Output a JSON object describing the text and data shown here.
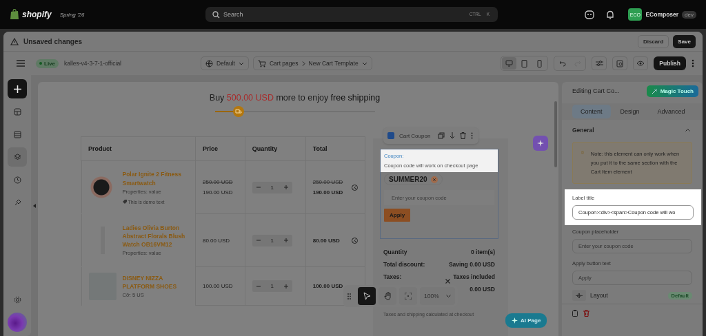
{
  "top_bar": {
    "logo": "shopify",
    "version": "Spring '26",
    "search": {
      "placeholder": "Search",
      "shortcut": [
        "CTRL",
        "K"
      ]
    },
    "account": {
      "initials": "ECO",
      "name": "EComposer",
      "badge": "dev"
    }
  },
  "unsaved_bar": {
    "message": "Unsaved changes",
    "buttons": [
      {
        "label": "Discard",
        "kind": "secondary"
      },
      {
        "label": "Save",
        "kind": "primary"
      }
    ]
  },
  "editor_toolbar": {
    "status": "Live",
    "theme": "kalles-v4-3-7-1-official",
    "language": "Default",
    "breadcrumb": [
      "Cart pages",
      "New Cart Template"
    ],
    "devices": [
      {
        "kind": "desktop",
        "selected": true
      },
      {
        "kind": "tablet",
        "selected": false
      },
      {
        "kind": "mobile",
        "selected": false
      }
    ],
    "history": [
      {
        "kind": "undo",
        "disabled": false
      },
      {
        "kind": "redo",
        "disabled": true
      }
    ],
    "publish": "Publish"
  },
  "sidebar": {
    "items": [
      {
        "kind": "add",
        "selected": false
      },
      {
        "kind": "blocks",
        "selected": false
      },
      {
        "kind": "sections",
        "selected": false
      },
      {
        "kind": "layers",
        "selected": true
      },
      {
        "kind": "history",
        "selected": false
      },
      {
        "kind": "style",
        "selected": false
      },
      {
        "kind": "settings",
        "selected": false
      }
    ]
  },
  "canvas": {
    "shipping": {
      "prefix": "Buy",
      "amount": "500.00 USD",
      "middle": "more to enjoy",
      "highlight": "free shipping",
      "level": 0.15
    },
    "cart_table": {
      "columns": [
        "Product",
        "Price",
        "Quantity",
        "Total"
      ],
      "rows": [
        {
          "name": "Polar Ignite 2 Fitness Smartwatch",
          "properties": "Properties: value",
          "note": "This is demo text",
          "price_original": "250.00 USD",
          "price": "190.00 USD",
          "quantity": "1",
          "total_original": "250.00 USD",
          "total": "190.00 USD",
          "remove_button": true
        },
        {
          "name": "Ladies Olivia Burton Abstract Florals Blush Watch OB16VM12",
          "properties": "Properties: value",
          "price": "80.00 USD",
          "quantity": "1",
          "total": "80.00 USD",
          "remove_button": true
        },
        {
          "name": "DISNEY NIZZA PLATFORM SHOES",
          "properties": "Cỡ: 5 US",
          "price": "100.00 USD",
          "quantity": "1",
          "total": "100.00 USD",
          "remove_button": false
        }
      ]
    },
    "element_toolbar": {
      "label": "Cart Coupon"
    },
    "coupon": {
      "highlighted": true,
      "title": "Coupon:",
      "text": "Coupon code will work on checkout page",
      "applied_code": "SUMMER20",
      "placeholder": "Enter your coupon code",
      "button": "Apply"
    },
    "summary": {
      "rows": [
        {
          "label": "Quantity",
          "value": "0 item(s)"
        },
        {
          "label": "Total discount:",
          "value": "Saving 0.00 USD"
        },
        {
          "label": "Taxes:",
          "value": "Taxes included"
        },
        {
          "value": "0.00 USD"
        }
      ],
      "note": "Taxes and shipping calculated at checkout"
    },
    "zoom_toolbar": {
      "tools": [
        {
          "kind": "select",
          "selected": true
        },
        {
          "kind": "hand",
          "selected": false
        },
        {
          "kind": "fit",
          "selected": false
        }
      ],
      "zoom": "100%"
    },
    "ai_button": "AI Page"
  },
  "right_panel": {
    "title": "Editing Cart Co...",
    "magic_button": "Magic Touch",
    "tabs": [
      {
        "label": "Content",
        "selected": true
      },
      {
        "label": "Design",
        "selected": false
      },
      {
        "label": "Advanced",
        "selected": false
      }
    ],
    "section": {
      "title": "General",
      "expanded": true
    },
    "note": "Note: this element can only work when you put it to the same section with the Cart Item element",
    "fields": [
      {
        "label": "Label title",
        "value": "Coupon:<div><span>Coupon code will wo",
        "highlighted": true
      },
      {
        "label": "Coupon placeholder",
        "placeholder": "Enter your coupon code",
        "highlighted": false
      },
      {
        "label": "Apply button text",
        "placeholder": "Apply",
        "highlighted": false
      }
    ],
    "layout": {
      "label": "Layout",
      "badge": "Default"
    }
  }
}
